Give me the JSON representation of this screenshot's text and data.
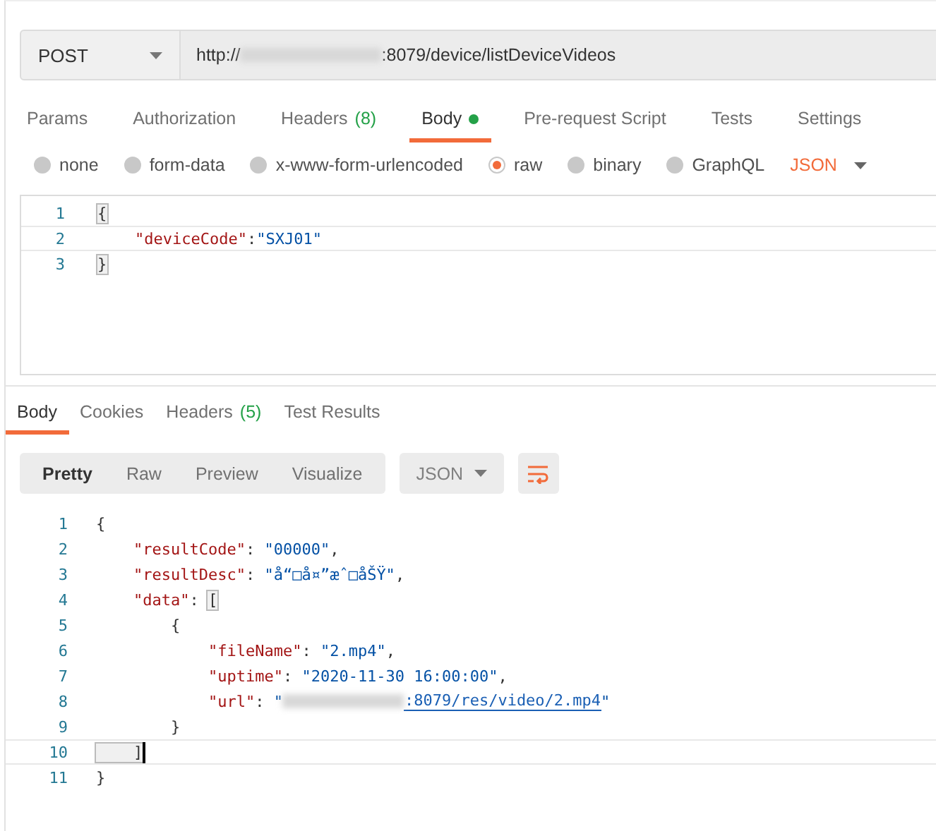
{
  "request": {
    "method": "POST",
    "url_start": "http://",
    "url_end": ":8079/device/listDeviceVideos"
  },
  "request_tabs": [
    {
      "label": "Params",
      "selected": false
    },
    {
      "label": "Authorization",
      "selected": false
    },
    {
      "label": "Headers",
      "count": "(8)",
      "selected": false
    },
    {
      "label": "Body",
      "has_content": true,
      "selected": true
    },
    {
      "label": "Pre-request Script",
      "selected": false
    },
    {
      "label": "Tests",
      "selected": false
    },
    {
      "label": "Settings",
      "selected": false
    }
  ],
  "body_types": [
    {
      "label": "none",
      "selected": false
    },
    {
      "label": "form-data",
      "selected": false
    },
    {
      "label": "x-www-form-urlencoded",
      "selected": false
    },
    {
      "label": "raw",
      "selected": true
    },
    {
      "label": "binary",
      "selected": false
    },
    {
      "label": "GraphQL",
      "selected": false
    }
  ],
  "body_format": "JSON",
  "request_body": [
    {
      "number": "1",
      "active": false,
      "tokens": [
        {
          "kind": "match",
          "text": "{"
        }
      ]
    },
    {
      "number": "2",
      "active": true,
      "tokens": [
        {
          "kind": "key",
          "text": "    \"deviceCode\""
        },
        {
          "kind": "punct",
          "text": ":"
        },
        {
          "kind": "string",
          "text": "\"SXJ01\""
        }
      ]
    },
    {
      "number": "3",
      "active": false,
      "tokens": [
        {
          "kind": "match",
          "text": "}"
        }
      ]
    }
  ],
  "response_tabs": [
    {
      "label": "Body",
      "selected": true
    },
    {
      "label": "Cookies",
      "selected": false
    },
    {
      "label": "Headers",
      "count": "(5)",
      "selected": false
    },
    {
      "label": "Test Results",
      "selected": false
    }
  ],
  "view_modes": [
    {
      "label": "Pretty",
      "selected": true
    },
    {
      "label": "Raw",
      "selected": false
    },
    {
      "label": "Preview",
      "selected": false
    },
    {
      "label": "Visualize",
      "selected": false
    }
  ],
  "response_format": "JSON",
  "response_body": [
    {
      "number": "1",
      "active": false,
      "tokens": [
        {
          "kind": "punct",
          "text": "{"
        }
      ]
    },
    {
      "number": "2",
      "active": false,
      "tokens": [
        {
          "kind": "key",
          "text": "    \"resultCode\""
        },
        {
          "kind": "punct",
          "text": ": "
        },
        {
          "kind": "string",
          "text": "\"00000\""
        },
        {
          "kind": "punct",
          "text": ","
        }
      ]
    },
    {
      "number": "3",
      "active": false,
      "tokens": [
        {
          "kind": "key",
          "text": "    \"resultDesc\""
        },
        {
          "kind": "punct",
          "text": ": "
        },
        {
          "kind": "string",
          "text": "\"å“□å¤”æˆ□åŠŸ\""
        },
        {
          "kind": "punct",
          "text": ","
        }
      ]
    },
    {
      "number": "4",
      "active": false,
      "tokens": [
        {
          "kind": "key",
          "text": "    \"data\""
        },
        {
          "kind": "punct",
          "text": ": "
        },
        {
          "kind": "match",
          "text": "["
        }
      ]
    },
    {
      "number": "5",
      "active": false,
      "tokens": [
        {
          "kind": "punct",
          "text": "        {"
        }
      ]
    },
    {
      "number": "6",
      "active": false,
      "tokens": [
        {
          "kind": "key",
          "text": "            \"fileName\""
        },
        {
          "kind": "punct",
          "text": ": "
        },
        {
          "kind": "string",
          "text": "\"2.mp4\""
        },
        {
          "kind": "punct",
          "text": ","
        }
      ]
    },
    {
      "number": "7",
      "active": false,
      "tokens": [
        {
          "kind": "key",
          "text": "            \"uptime\""
        },
        {
          "kind": "punct",
          "text": ": "
        },
        {
          "kind": "string",
          "text": "\"2020-11-30 16:00:00\""
        },
        {
          "kind": "punct",
          "text": ","
        }
      ]
    },
    {
      "number": "8",
      "active": false,
      "tokens": [
        {
          "kind": "key",
          "text": "            \"url\""
        },
        {
          "kind": "punct",
          "text": ": "
        },
        {
          "kind": "string",
          "text": "\""
        },
        {
          "kind": "link",
          "text": ":8079/res/video/2.mp4"
        },
        {
          "kind": "string",
          "text": "\""
        }
      ]
    },
    {
      "number": "9",
      "active": false,
      "tokens": [
        {
          "kind": "punct",
          "text": "        }"
        }
      ]
    },
    {
      "number": "10",
      "active": true,
      "tokens": [
        {
          "kind": "match",
          "text": "    ]"
        }
      ]
    },
    {
      "number": "11",
      "active": false,
      "tokens": [
        {
          "kind": "punct",
          "text": "}"
        }
      ]
    }
  ]
}
